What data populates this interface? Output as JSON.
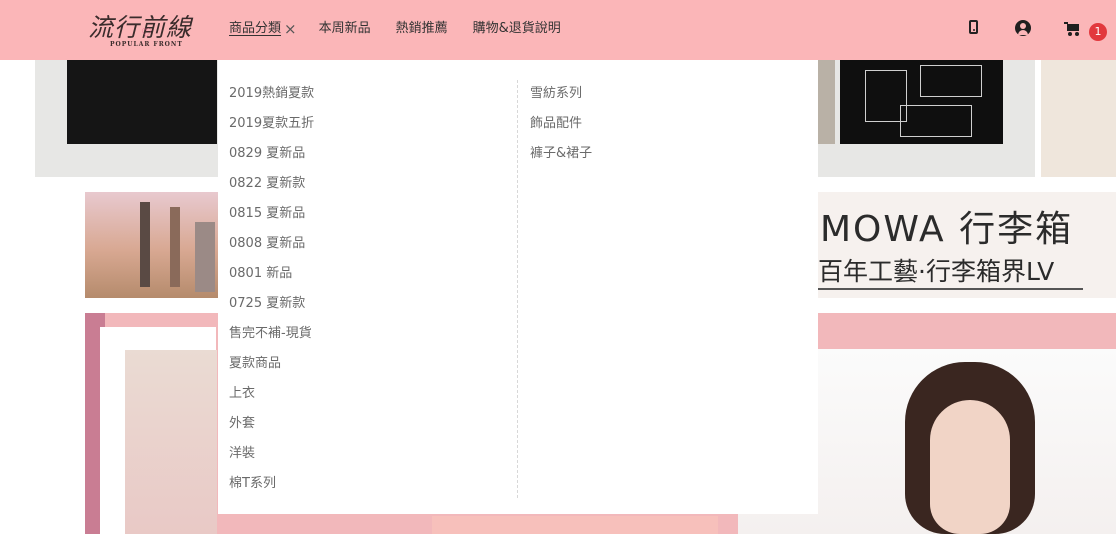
{
  "header": {
    "logo": {
      "title": "流行前線",
      "subtitle": "POPULAR FRONT"
    },
    "nav": [
      {
        "label": "商品分類",
        "active": true
      },
      {
        "label": "本周新品"
      },
      {
        "label": "熱銷推薦"
      },
      {
        "label": "購物&退貨說明"
      }
    ],
    "close_icon": "×",
    "cart_count": "1",
    "icons": [
      "mobile-icon",
      "user-icon",
      "cart-icon"
    ]
  },
  "dropdown": {
    "left_items": [
      "2019熱銷夏款",
      "2019夏款五折",
      "0829 夏新品",
      "0822 夏新款",
      "0815 夏新品",
      "0808 夏新品",
      "0801 新品",
      "0725 夏新款",
      "售完不補-現貨",
      "夏款商品",
      "上衣",
      "外套",
      "洋裝",
      "棉T系列"
    ],
    "right_items": [
      "雪紡系列",
      "飾品配件",
      "褲子&裙子"
    ]
  },
  "banner": {
    "line1": "MOWA 行李箱",
    "line2": "百年工藝·行李箱界LV"
  },
  "colors": {
    "header_bg": "#fbb6b8",
    "badge_bg": "#e2383d",
    "promo_bg": "#f2b8bb"
  }
}
